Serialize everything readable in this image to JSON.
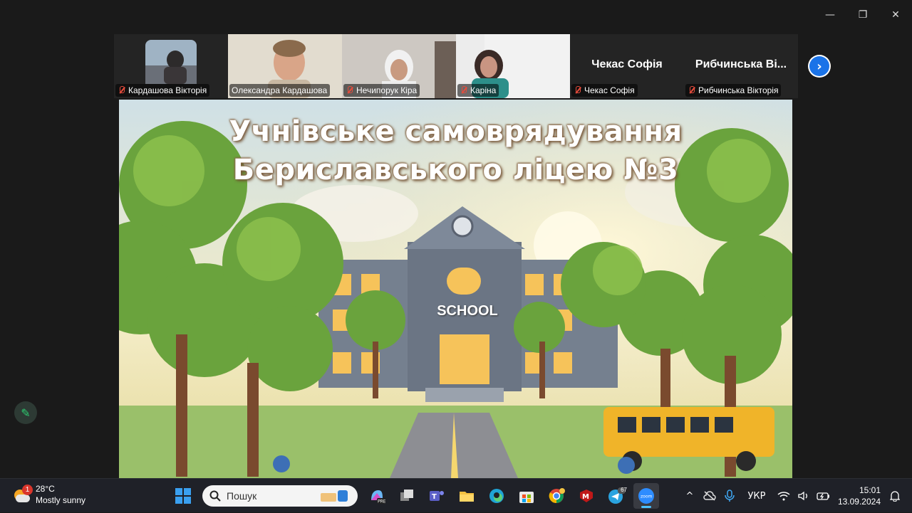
{
  "window": {
    "controls": {
      "minimize": "—",
      "restore": "❐",
      "close": "✕"
    }
  },
  "participants": [
    {
      "name": "Кардашова Вікторія",
      "muted": true
    },
    {
      "name": "Олександра Кардашова",
      "muted": false,
      "active": true
    },
    {
      "name": "Нечипорук Кіра",
      "muted": true
    },
    {
      "name": "Каріна",
      "muted": true
    },
    {
      "name": "Чекас Софія",
      "display_name": "Чекас Софія",
      "muted": true
    },
    {
      "name": "Рибчинська Вікторія",
      "display_name": "Рибчинська Ві...",
      "muted": true
    }
  ],
  "next_icon": "›",
  "slide": {
    "title_line1": "Учнівське самоврядування",
    "title_line2": "Бериславського ліцею №3",
    "sign": "SCHOOL"
  },
  "annotate_icon": "✎",
  "taskbar": {
    "weather": {
      "badge": "1",
      "temp": "28°C",
      "condition": "Mostly sunny"
    },
    "search_placeholder": "Пошук",
    "telegram_badge": "67",
    "tray": {
      "chevron": "^",
      "language": "УКР"
    },
    "time": "15:01",
    "date": "13.09.2024"
  }
}
